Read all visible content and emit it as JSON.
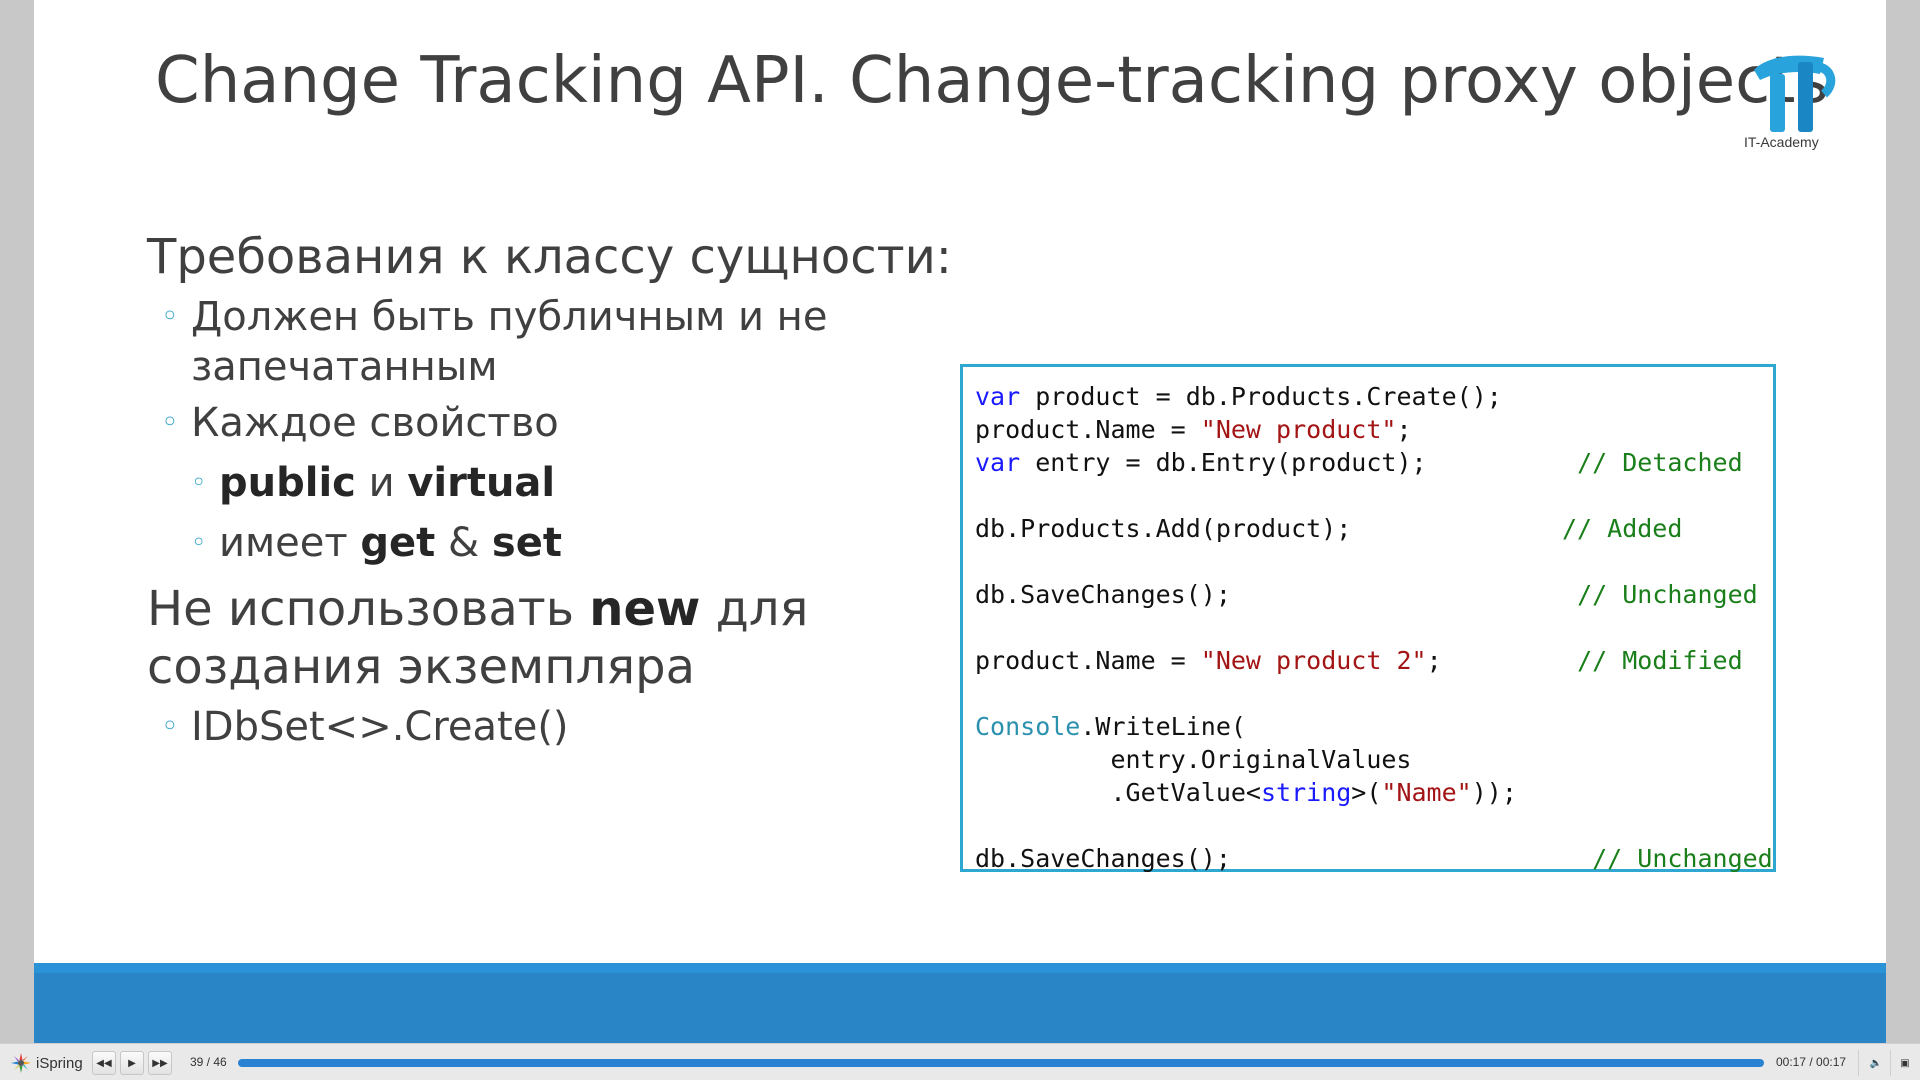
{
  "slide": {
    "title": "Change Tracking API. Change-tracking proxy objects",
    "logo_caption": "IT-Academy",
    "heading1": "Требования к классу сущности:",
    "bullet1_line1": "Должен быть публичным и не",
    "bullet1_line2": "запечатанным",
    "bullet2": "Каждое свойство",
    "sub1_a": "public",
    "sub1_b": " и ",
    "sub1_c": "virtual",
    "sub2_a": "имеет ",
    "sub2_b": "get",
    "sub2_c": " & ",
    "sub2_d": "set",
    "heading2_a": "Не использовать ",
    "heading2_b": "new",
    "heading2_c": " для",
    "heading2_line2": "создания экземпляра",
    "bullet3": "IDbSet<>.Create()"
  },
  "code_tokens": [
    "var",
    " product = db.Products.Create();\nproduct.Name = ",
    "\"New product\"",
    ";\n",
    "var",
    " entry = db.Entry(product);          ",
    "// Detached",
    "\n\ndb.Products.Add(product);              ",
    "// Added",
    "\n\ndb.SaveChanges();                       ",
    "// Unchanged",
    "\n\nproduct.Name = ",
    "\"New product 2\"",
    ";         ",
    "// Modified",
    "\n\n",
    "Console",
    ".WriteLine(\n         entry.OriginalValues\n         .GetValue<",
    "string",
    ">(",
    "\"Name\"",
    "));\n\ndb.SaveChanges();                        ",
    "// Unchanged"
  ],
  "player": {
    "brand": "iSpring",
    "slide_counter": "39 / 46",
    "time": "00:17 / 00:17",
    "progress": 1.0,
    "prev_icon": "skip-back-icon",
    "play_icon": "play-icon",
    "next_icon": "skip-forward-icon",
    "volume_icon": "volume-icon",
    "fullscreen_icon": "fullscreen-icon"
  }
}
